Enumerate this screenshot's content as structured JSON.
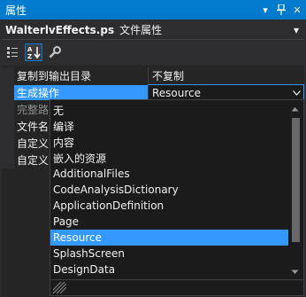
{
  "panel": {
    "title": "属性",
    "dropdown_glyph": "▾",
    "pin_glyph": "ᚹ",
    "close_glyph": "✕"
  },
  "object_selector": {
    "name": "WalterlvEffects.ps",
    "type": "文件属性",
    "arrow": "▾"
  },
  "toolbar": {
    "categorized": "categorized-icon",
    "alphabetical": "alphabetical-sort-icon",
    "property_pages": "wrench-icon"
  },
  "properties": [
    {
      "name": "复制到输出目录",
      "value": "不复制"
    },
    {
      "name": "生成操作",
      "value": "Resource"
    },
    {
      "name": "完整路",
      "value": ""
    },
    {
      "name": "文件名",
      "value": ""
    },
    {
      "name": "自定义",
      "value": ""
    },
    {
      "name": "自定义",
      "value": ""
    }
  ],
  "dropdown": {
    "items": [
      "无",
      "编译",
      "内容",
      "嵌入的资源",
      "AdditionalFiles",
      "CodeAnalysisDictionary",
      "ApplicationDefinition",
      "Page",
      "Resource",
      "SplashScreen",
      "DesignData"
    ],
    "selected_index": 8
  },
  "colors": {
    "accent": "#007acc",
    "selection": "#3399ff",
    "background": "#2d2d30"
  }
}
